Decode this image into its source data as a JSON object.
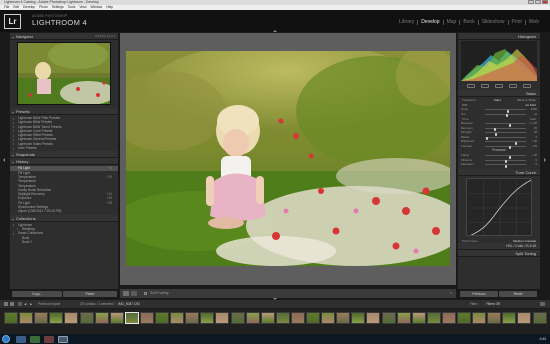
{
  "window": {
    "title": "Lightroom 4 Catalog - Adobe Photoshop Lightroom - Develop"
  },
  "menu": [
    "File",
    "Edit",
    "Develop",
    "Photo",
    "Settings",
    "Tools",
    "View",
    "Window",
    "Help"
  ],
  "identity": {
    "logo": "Lr",
    "small": "ADOBE PHOTOSHOP",
    "big": "LIGHTROOM 4"
  },
  "modules": {
    "items": [
      "Library",
      "Develop",
      "Map",
      "Book",
      "Slideshow",
      "Print",
      "Web"
    ],
    "active": "Develop"
  },
  "left_panel": {
    "navigator": {
      "title": "Navigator",
      "options": "FIT  FILL  1:1  3:1"
    },
    "presets": {
      "title": "Presets",
      "items": [
        "Lightroom B&W Filter Presets",
        "Lightroom B&W Presets",
        "Lightroom B&W Toned Presets",
        "Lightroom Color Presets",
        "Lightroom Effect Presets",
        "Lightroom General Presets",
        "Lightroom Video Presets",
        "User Presets"
      ]
    },
    "snapshots": {
      "title": "Snapshots"
    },
    "history": {
      "title": "History",
      "items": [
        {
          "label": "Fill Light",
          "value": "+3"
        },
        {
          "label": "Fill Light",
          "value": ""
        },
        {
          "label": "Temperature",
          "value": "+14"
        },
        {
          "label": "Temperature",
          "value": ""
        },
        {
          "label": "Temperature",
          "value": ""
        },
        {
          "label": "Clarity Noise Reduction",
          "value": ""
        },
        {
          "label": "Highlight Recovery",
          "value": "+14"
        },
        {
          "label": "Exposure",
          "value": "+25"
        },
        {
          "label": "Fill Light",
          "value": "+28"
        },
        {
          "label": "Synchronize Settings",
          "value": ""
        },
        {
          "label": "Import (10/6/2012 7:23:43 PM)",
          "value": ""
        }
      ]
    },
    "collections": {
      "title": "Collections",
      "items": [
        "Lightroom",
        "Wedding",
        "Smart Collections",
        "Book",
        "Book 2"
      ]
    }
  },
  "left_buttons": {
    "copy": "Copy...",
    "paste": "Paste"
  },
  "right_panel": {
    "histogram": {
      "title": "Histogram"
    },
    "basic": {
      "title": "Basic",
      "treatment": [
        "Treatment :",
        "Color",
        "Black & White"
      ],
      "wb_label": "WB :",
      "wb_value": "As Shot",
      "tone_label": "Tone",
      "tone_auto": "Auto",
      "presence_label": "Presence",
      "sliders": [
        {
          "label": "Temp",
          "value": "4800",
          "pos": 0.56
        },
        {
          "label": "Tint",
          "value": "+6",
          "pos": 0.53
        },
        {
          "label": "Exposure",
          "value": "+ 1.00",
          "pos": 0.62
        },
        {
          "label": "Recovery",
          "value": "25",
          "pos": 0.25
        },
        {
          "label": "Fill Light",
          "value": "28",
          "pos": 0.28
        },
        {
          "label": "Blacks",
          "value": "5",
          "pos": 0.05
        },
        {
          "label": "Brightness",
          "value": "+ 50",
          "pos": 0.75
        },
        {
          "label": "Contrast",
          "value": "+ 25",
          "pos": 0.62
        },
        {
          "label": "Clarity",
          "value": "+ 20",
          "pos": 0.6
        },
        {
          "label": "Vibrance",
          "value": "0",
          "pos": 0.5
        },
        {
          "label": "Saturation",
          "value": "0",
          "pos": 0.5
        }
      ]
    },
    "tone_curve": {
      "title": "Tone Curve",
      "point_curve_label": "Point Curve :",
      "point_curve_value": "Medium Contrast"
    },
    "hsl": {
      "labels": [
        "HSL",
        "/",
        "Color",
        "/",
        "B & W"
      ]
    },
    "split_toning": {
      "title": "Split Toning"
    }
  },
  "right_buttons": {
    "previous": "Previous",
    "reset": "Reset"
  },
  "toolbar": {
    "soft_proofing": "Soft Proofing"
  },
  "filmstrip_bar": {
    "source": "Previous Import",
    "count": "372 photos / 1 selected /",
    "filename": "IMG_5087.CR2",
    "filter_label": "Filter :",
    "filter_value": "Filters Off"
  },
  "taskbar": {
    "time": "0:43"
  },
  "colors": {
    "panel_bg": "#2e2e2e",
    "stage_bg": "#5e5e5e",
    "active_module": "#ececec",
    "selected_row": "#505050"
  }
}
